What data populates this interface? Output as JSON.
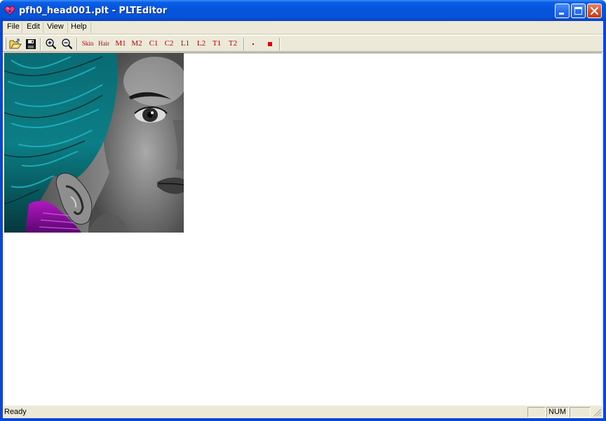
{
  "window": {
    "title": "pfh0_head001.plt - PLTEditor",
    "app_icon": "heart-app-icon",
    "title_colors": {
      "bar": "#0653d9",
      "close": "#c63d14"
    }
  },
  "menu": {
    "items": [
      {
        "id": "file",
        "label": "File"
      },
      {
        "id": "edit",
        "label": "Edit"
      },
      {
        "id": "view",
        "label": "View"
      },
      {
        "id": "help",
        "label": "Help"
      }
    ]
  },
  "toolbar": {
    "icons": {
      "open": "open-folder-icon",
      "save": "save-disk-icon",
      "zoom_in": "zoom-in-icon",
      "zoom_out": "zoom-out-icon"
    },
    "layers": {
      "skin": "Skin",
      "hair": "Hair",
      "m1": "M1",
      "m2": "M2",
      "c1": "C1",
      "c2": "C2",
      "l1": "L1",
      "l2": "L2",
      "t1": "T1",
      "t2": "T2"
    },
    "brush_icons": {
      "small": "small-brush-dot-icon",
      "large": "large-brush-square-icon"
    },
    "accent_color": "#c00000"
  },
  "canvas": {
    "image": "portrait-texture-image"
  },
  "status": {
    "text": "Ready",
    "num": "NUM"
  }
}
